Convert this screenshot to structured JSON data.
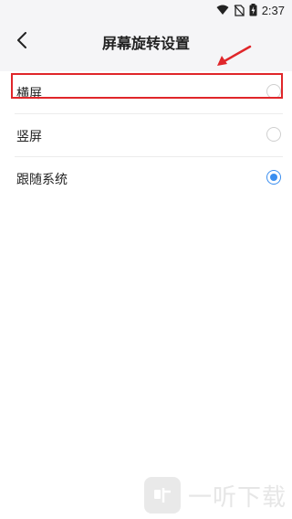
{
  "status": {
    "time": "2:37"
  },
  "header": {
    "title": "屏幕旋转设置"
  },
  "options": [
    {
      "label": "横屏",
      "selected": false
    },
    {
      "label": "竖屏",
      "selected": false
    },
    {
      "label": "跟随系统",
      "selected": true
    }
  ],
  "colors": {
    "accent": "#3a8ef0",
    "highlight": "#e0262a"
  },
  "watermark": {
    "text": "一听下载"
  }
}
